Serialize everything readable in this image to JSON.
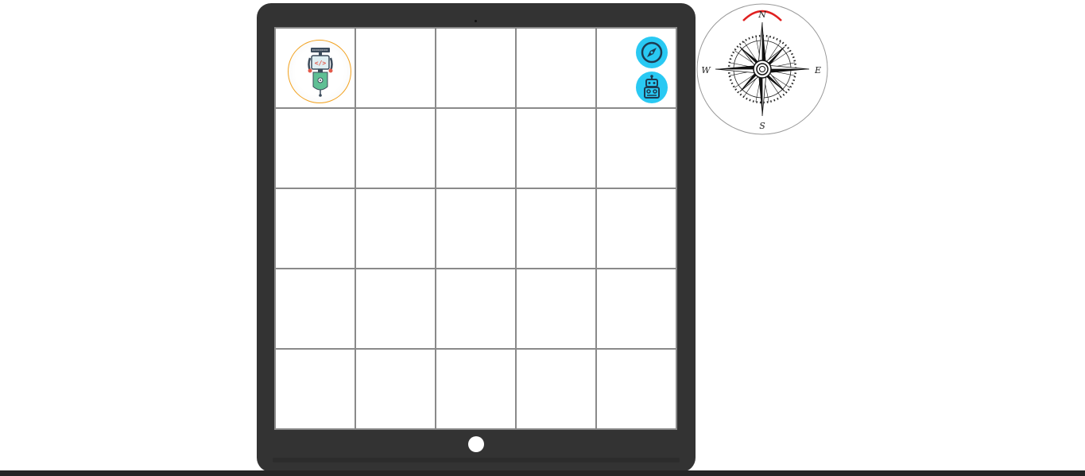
{
  "board": {
    "rows": 5,
    "cols": 5,
    "robot_position": {
      "row": 1,
      "col": 1
    },
    "robot_token_icon": "coder-robot-icon",
    "robot_code_glyph": "</>"
  },
  "controls": {
    "compass_button_icon": "compass-icon",
    "robot_button_icon": "robot-icon"
  },
  "compass": {
    "north": "N",
    "south": "S",
    "east": "E",
    "west": "W",
    "heading": "N"
  },
  "colors": {
    "tablet": "#333333",
    "accent_button": "#29c9f3",
    "token_ring": "#f2a11d",
    "heading_arc": "#e02020"
  }
}
